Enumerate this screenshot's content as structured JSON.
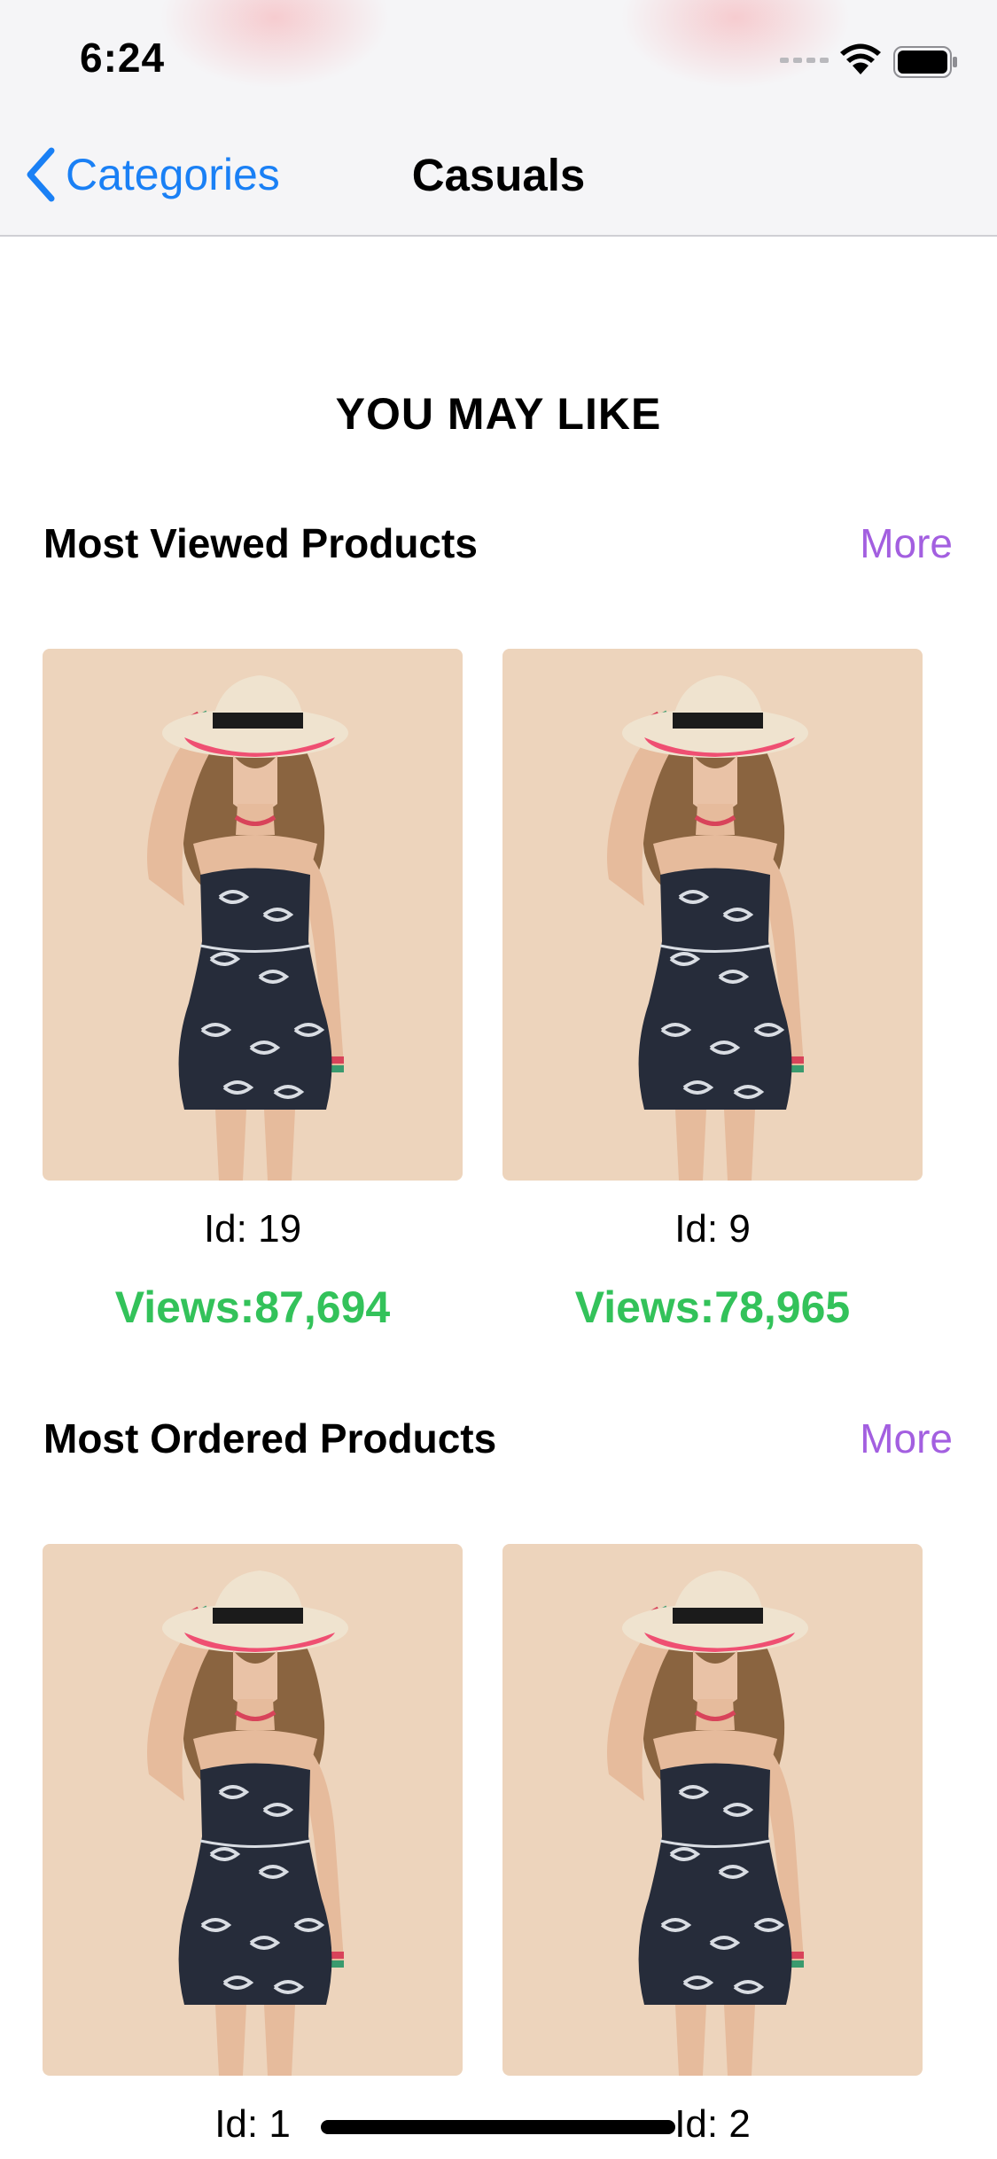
{
  "status_bar": {
    "time": "6:24"
  },
  "nav": {
    "back_label": "Categories",
    "title": "Casuals"
  },
  "section": {
    "heading": "YOU MAY LIKE"
  },
  "most_viewed": {
    "title": "Most Viewed Products",
    "more_label": "More",
    "products": [
      {
        "id_label": "Id: 19",
        "views_label": "Views:87,694"
      },
      {
        "id_label": "Id: 9",
        "views_label": "Views:78,965"
      }
    ]
  },
  "most_ordered": {
    "title": "Most Ordered Products",
    "more_label": "More",
    "products": [
      {
        "id_label": "Id: 1"
      },
      {
        "id_label": "Id: 2"
      }
    ]
  },
  "colors": {
    "accent_blue": "#1a80f5",
    "more_purple": "#a35fe0",
    "views_green": "#33c25a",
    "card_bg": "#edd4bc"
  }
}
